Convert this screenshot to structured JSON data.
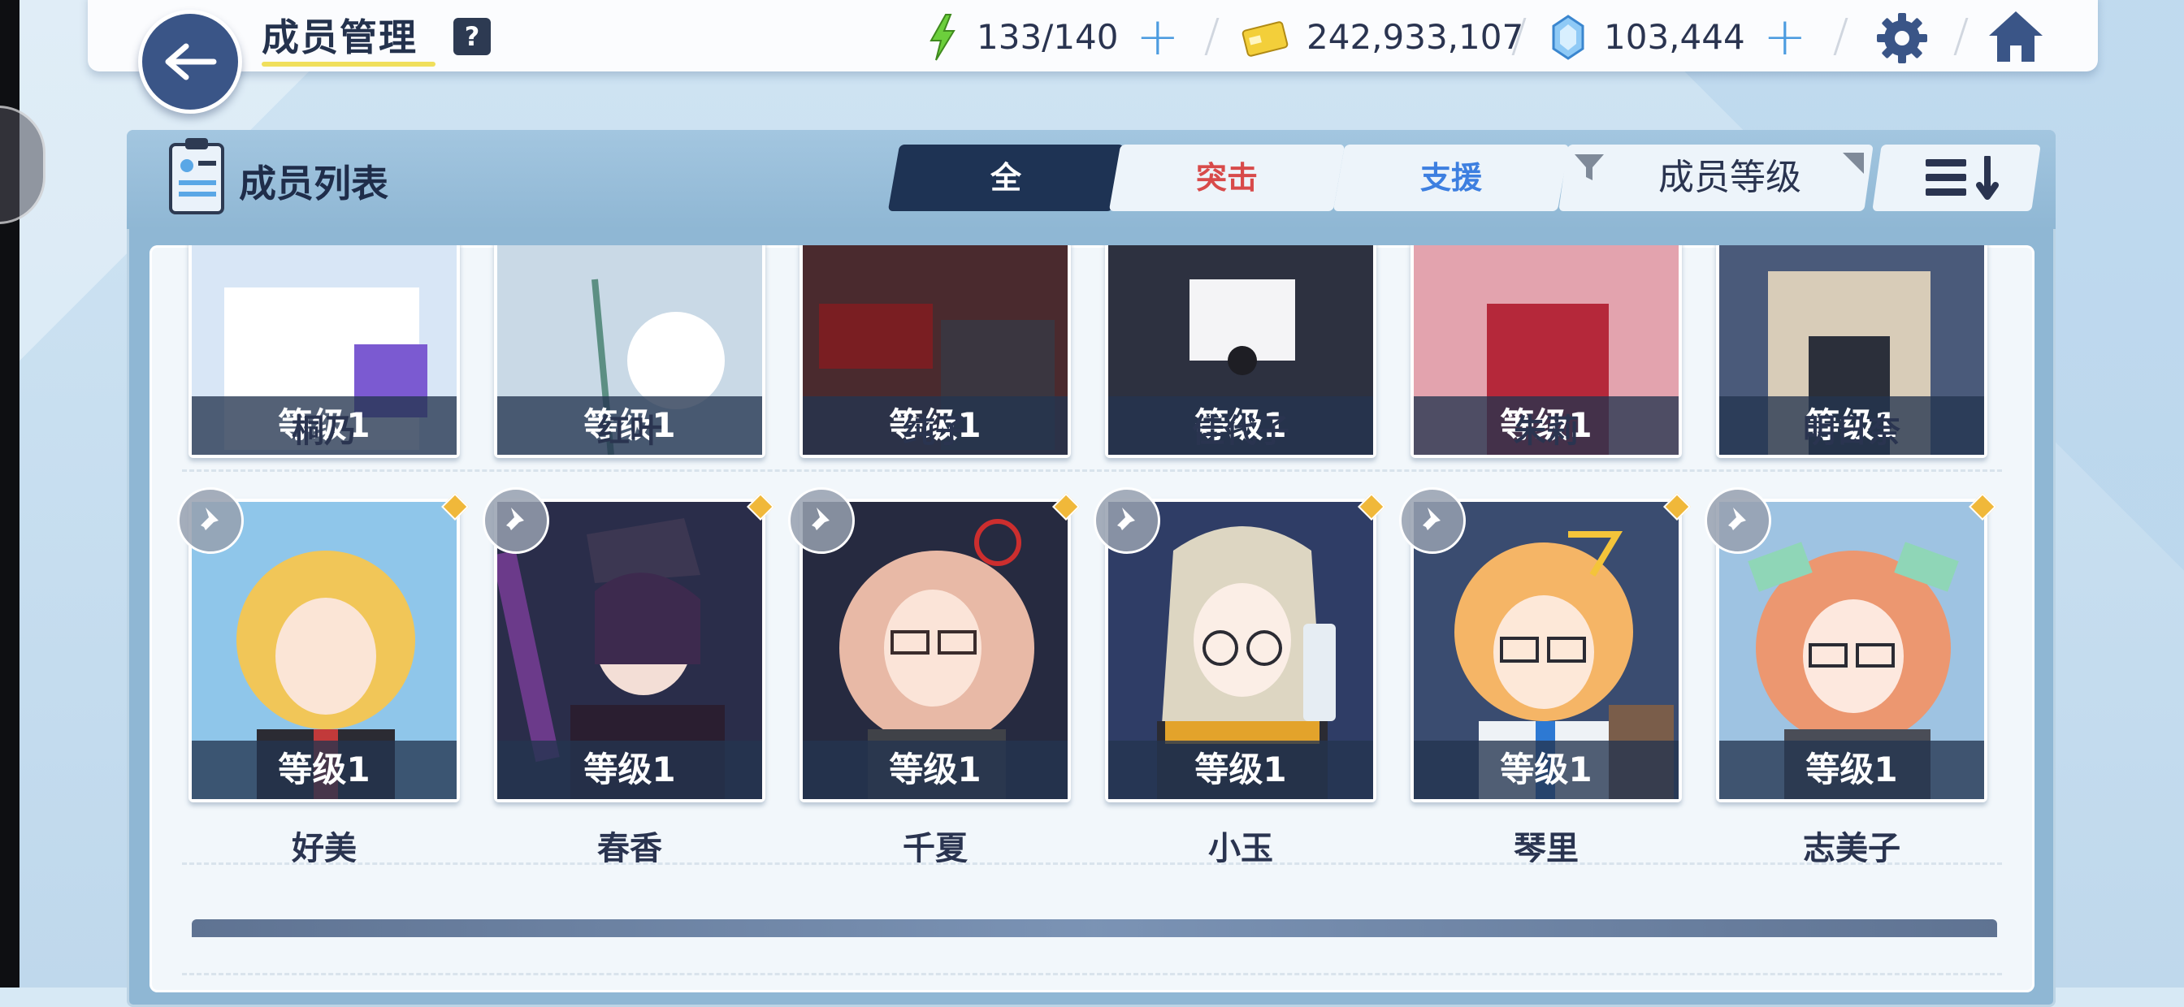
{
  "header": {
    "title": "成员管理",
    "help_label": "?",
    "stamina": "133/140",
    "credits": "242,933,107",
    "gems": "103,444"
  },
  "panel": {
    "title": "成员列表",
    "tabs": [
      {
        "label": "全",
        "active": true,
        "color": "#ffffff"
      },
      {
        "label": "突击",
        "active": false,
        "color": "#d84a4a"
      },
      {
        "label": "支援",
        "active": false,
        "color": "#3d7fe0"
      }
    ],
    "sort_label": "成员等级"
  },
  "members_row1": [
    {
      "name": "桐乃",
      "level": "等级1"
    },
    {
      "name": "红叶",
      "level": "等级1"
    },
    {
      "name": "纯子",
      "level": "等级1"
    },
    {
      "name": "佳代子",
      "level": "等级1"
    },
    {
      "name": "朱莉",
      "level": "等级1"
    },
    {
      "name": "明日奈",
      "level": "等级1"
    }
  ],
  "members_row2": [
    {
      "name": "好美",
      "level": "等级1"
    },
    {
      "name": "春香",
      "level": "等级1"
    },
    {
      "name": "千夏",
      "level": "等级1"
    },
    {
      "name": "小玉",
      "level": "等级1"
    },
    {
      "name": "琴里",
      "level": "等级1"
    },
    {
      "name": "志美子",
      "level": "等级1"
    }
  ],
  "colors": {
    "accent_navy": "#1e3354",
    "highlight_yellow": "#f0df5c",
    "plus_blue": "#4d9ce0"
  },
  "icons": [
    "back-arrow-icon",
    "help-icon",
    "stamina-bolt-icon",
    "credit-card-icon",
    "gem-icon",
    "plus-icon",
    "gear-icon",
    "home-icon",
    "member-list-icon",
    "filter-icon",
    "sort-order-icon",
    "pin-icon"
  ]
}
